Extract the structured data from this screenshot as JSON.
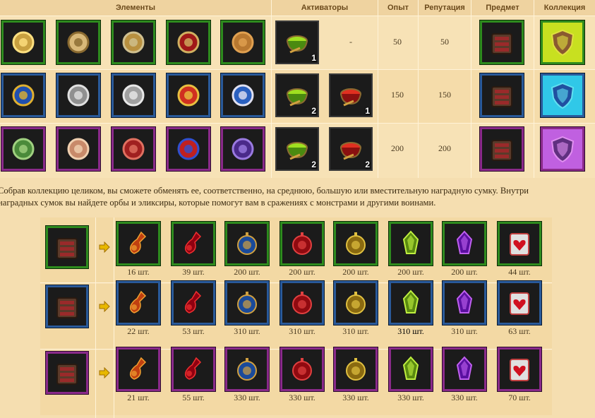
{
  "headers": {
    "elements": "Элементы",
    "activators": "Активаторы",
    "exp": "Опыт",
    "reputation": "Репутация",
    "item": "Предмет",
    "collection": "Коллекция"
  },
  "rows": [
    {
      "tier": "green",
      "elements": [
        "lantern-icon",
        "treasure-map-icon",
        "compass-icon",
        "spyglass-icon",
        "bell-icon"
      ],
      "activators": [
        {
          "icon": "green-potion-bowl-icon",
          "count": "1"
        }
      ],
      "activator_empty": "-",
      "exp": "50",
      "reputation": "50",
      "item": "reward-bag-icon",
      "collection": "bronze-shield-icon"
    },
    {
      "tier": "blue",
      "elements": [
        "crest-shield-icon",
        "knight-statuette-icon",
        "pegasus-statuette-icon",
        "medal-rosette-icon",
        "sword-emblem-icon"
      ],
      "activators": [
        {
          "icon": "green-potion-bowl-icon",
          "count": "2"
        },
        {
          "icon": "red-potion-bowl-icon",
          "count": "1"
        }
      ],
      "exp": "150",
      "reputation": "150",
      "item": "reward-bag-icon",
      "collection": "blue-shield-icon"
    },
    {
      "tier": "purple",
      "elements": [
        "orc-head-icon",
        "fang-icon",
        "claw-icon",
        "feather-plume-icon",
        "helmet-icon"
      ],
      "activators": [
        {
          "icon": "green-potion-bowl-icon",
          "count": "2"
        },
        {
          "icon": "red-potion-bowl-icon",
          "count": "2"
        }
      ],
      "exp": "200",
      "reputation": "200",
      "item": "reward-bag-icon",
      "collection": "purple-shield-icon"
    }
  ],
  "description": {
    "line1": "Собрав коллекцию целиком, вы сможете обменять ее, соответственно, на среднюю, большую или вместительную наградную сумку. Внутри",
    "line2": "наградных  сумок вы найдете орбы и эликсиры, которые помогут вам в сражениях с монстрами и другими воинами."
  },
  "rewards": [
    {
      "tier": "green",
      "bag": "reward-bag-icon",
      "items": [
        {
          "icon": "orange-elixir-icon",
          "qty": "16 шт."
        },
        {
          "icon": "red-elixir-icon",
          "qty": "39 шт."
        },
        {
          "icon": "blue-orb-icon",
          "qty": "200 шт."
        },
        {
          "icon": "red-orb-icon",
          "qty": "200 шт."
        },
        {
          "icon": "gold-orb-icon",
          "qty": "200 шт."
        },
        {
          "icon": "green-crystal-icon",
          "qty": "200 шт."
        },
        {
          "icon": "purple-crystal-icon",
          "qty": "200 шт."
        },
        {
          "icon": "heart-scroll-icon",
          "qty": "44 шт."
        }
      ]
    },
    {
      "tier": "blue",
      "bag": "reward-bag-icon",
      "items": [
        {
          "icon": "orange-elixir-icon",
          "qty": "22 шт."
        },
        {
          "icon": "red-elixir-icon",
          "qty": "53 шт."
        },
        {
          "icon": "blue-orb-icon",
          "qty": "310 шт."
        },
        {
          "icon": "red-orb-icon",
          "qty": "310 шт."
        },
        {
          "icon": "gold-orb-icon",
          "qty": "310 шт."
        },
        {
          "icon": "green-crystal-icon",
          "qty": "310 шт."
        },
        {
          "icon": "purple-crystal-icon",
          "qty": "310 шт."
        },
        {
          "icon": "heart-scroll-icon",
          "qty": "63 шт."
        }
      ]
    },
    {
      "tier": "purple",
      "bag": "reward-bag-icon",
      "items": [
        {
          "icon": "orange-elixir-icon",
          "qty": "21 шт."
        },
        {
          "icon": "red-elixir-icon",
          "qty": "55 шт."
        },
        {
          "icon": "blue-orb-icon",
          "qty": "330 шт."
        },
        {
          "icon": "red-orb-icon",
          "qty": "330 шт."
        },
        {
          "icon": "gold-orb-icon",
          "qty": "330 шт."
        },
        {
          "icon": "green-crystal-icon",
          "qty": "330 шт."
        },
        {
          "icon": "purple-crystal-icon",
          "qty": "330 шт."
        },
        {
          "icon": "heart-scroll-icon",
          "qty": "70 шт."
        }
      ]
    }
  ],
  "colors": {
    "green": "#2e8b1e",
    "blue": "#2a5a9a",
    "purple": "#8a2a8a",
    "background": "#f5deb0",
    "arrow": "#e8b800"
  }
}
